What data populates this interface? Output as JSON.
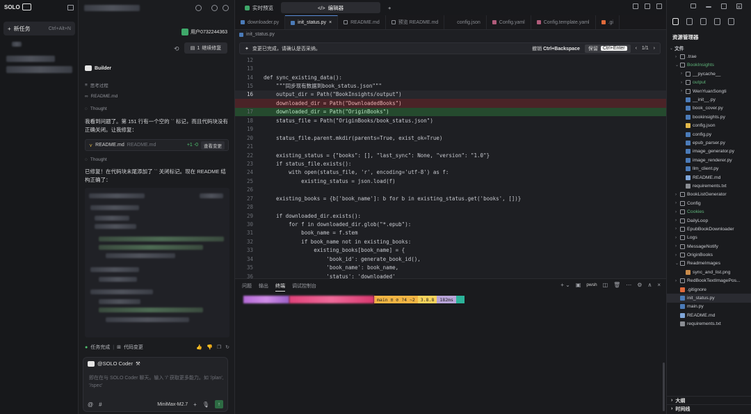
{
  "sidebar": {
    "logo_text": "SOLO",
    "new_task_label": "新任务",
    "new_task_shortcut": "Ctrl+Alt+N"
  },
  "chat": {
    "user_label": "用户0732244363",
    "continue_edit_label": "继续修复",
    "continue_edit_count": "1",
    "agent_name": "Builder",
    "think_process_label": "思考过程",
    "readme_ref": "README.md",
    "thought_label": "Thought",
    "message1": "我看到问题了。第 151 行有一个空的 `` 标记，而且代码块没有正确关闭。让我修复：",
    "file_card": {
      "name": "README.md",
      "path": "README.md",
      "diff": "+1 -0",
      "view_label": "查看变更"
    },
    "thought_label_2": "Thought",
    "message2": "已修复！在代码块末尾添加了 `` 关闭标记。现在 README 结构正确了：",
    "task_done_label": "任务完成",
    "code_changes_label": "代码变更",
    "input": {
      "agent_chip": "@SOLO Coder",
      "placeholder": "即在在与 SOLO Coder 聊天。输入 '/' 获取更多能力。如 '/plan', '/spec'",
      "model": "MiniMax-M2.7"
    }
  },
  "editor": {
    "top_tabs": [
      {
        "label": "实时预览"
      },
      {
        "label": "编辑器"
      }
    ],
    "file_tabs": [
      {
        "label": "downloader.py"
      },
      {
        "label": "init_status.py"
      },
      {
        "label": "README.md"
      },
      {
        "label": "预览 README.md"
      },
      {
        "label": "config.json"
      },
      {
        "label": "Config.yaml"
      },
      {
        "label": "Config.template.yaml"
      },
      {
        "label": ".gi"
      }
    ],
    "breadcrumb": "init_status.py",
    "banner": {
      "message": "变更已完成，请确认是否采纳。",
      "reject_label": "撤销",
      "reject_shortcut": "Ctrl+Backspace",
      "keep_label": "保留",
      "keep_shortcut": "Ctrl+Enter",
      "page": "1/1"
    },
    "code_lines": [
      {
        "n": "12",
        "t": "",
        "k": ""
      },
      {
        "n": "13",
        "t": "",
        "k": ""
      },
      {
        "n": "14",
        "t": "def sync_existing_data():",
        "k": ""
      },
      {
        "n": "15",
        "t": "    \"\"\"同步现有数据到book_status.json\"\"\"",
        "k": ""
      },
      {
        "n": "16",
        "t": "    output_dir = Path(\"BookInsights/output\")",
        "k": "cur"
      },
      {
        "n": "",
        "t": "    downloaded_dir = Path(\"DownloadedBooks\")",
        "k": "del"
      },
      {
        "n": "17",
        "t": "    downloaded_dir = Path(\"OriginBooks\")",
        "k": "add"
      },
      {
        "n": "18",
        "t": "    status_file = Path(\"OriginBooks/book_status.json\")",
        "k": ""
      },
      {
        "n": "19",
        "t": "",
        "k": ""
      },
      {
        "n": "20",
        "t": "    status_file.parent.mkdir(parents=True, exist_ok=True)",
        "k": ""
      },
      {
        "n": "21",
        "t": "",
        "k": ""
      },
      {
        "n": "22",
        "t": "    existing_status = {\"books\": [], \"last_sync\": None, \"version\": \"1.0\"}",
        "k": ""
      },
      {
        "n": "23",
        "t": "    if status_file.exists():",
        "k": ""
      },
      {
        "n": "24",
        "t": "        with open(status_file, 'r', encoding='utf-8') as f:",
        "k": ""
      },
      {
        "n": "25",
        "t": "            existing_status = json.load(f)",
        "k": ""
      },
      {
        "n": "26",
        "t": "",
        "k": ""
      },
      {
        "n": "27",
        "t": "    existing_books = {b['book_name']: b for b in existing_status.get('books', [])}",
        "k": ""
      },
      {
        "n": "28",
        "t": "",
        "k": ""
      },
      {
        "n": "29",
        "t": "    if downloaded_dir.exists():",
        "k": ""
      },
      {
        "n": "30",
        "t": "        for f in downloaded_dir.glob(\"*.epub\"):",
        "k": ""
      },
      {
        "n": "31",
        "t": "            book_name = f.stem",
        "k": ""
      },
      {
        "n": "32",
        "t": "            if book_name not in existing_books:",
        "k": ""
      },
      {
        "n": "33",
        "t": "                existing_books[book_name] = {",
        "k": ""
      },
      {
        "n": "34",
        "t": "                    'book_id': generate_book_id(),",
        "k": ""
      },
      {
        "n": "35",
        "t": "                    'book_name': book_name,",
        "k": ""
      },
      {
        "n": "36",
        "t": "                    'status': 'downloaded'",
        "k": ""
      }
    ],
    "panel": {
      "tabs": [
        "问题",
        "输出",
        "终端",
        "调试控制台"
      ],
      "shell": "pwsh",
      "prompt": {
        "git": " main ≡ ⊘ ?4 ~2",
        "version": " 3.8.8",
        "time": " 182ms"
      }
    }
  },
  "explorer": {
    "title": "资源管理器",
    "tree": [
      {
        "label": "文件",
        "d": 0,
        "type": "section"
      },
      {
        "label": ".trae",
        "d": 1,
        "type": "folder",
        "open": false
      },
      {
        "label": "BookInsights",
        "d": 1,
        "type": "folder",
        "open": true,
        "green": true
      },
      {
        "label": "__pycache__",
        "d": 2,
        "type": "folder",
        "open": false
      },
      {
        "label": "output",
        "d": 2,
        "type": "folder",
        "open": false,
        "green": true
      },
      {
        "label": "WenYuanSongti",
        "d": 2,
        "type": "folder",
        "open": false
      },
      {
        "label": "__init__.py",
        "d": 2,
        "type": "py"
      },
      {
        "label": "book_cover.py",
        "d": 2,
        "type": "py"
      },
      {
        "label": "bookinsights.py",
        "d": 2,
        "type": "py"
      },
      {
        "label": "config.json",
        "d": 2,
        "type": "json"
      },
      {
        "label": "config.py",
        "d": 2,
        "type": "py"
      },
      {
        "label": "epub_parser.py",
        "d": 2,
        "type": "py"
      },
      {
        "label": "image_generator.py",
        "d": 2,
        "type": "py"
      },
      {
        "label": "image_renderer.py",
        "d": 2,
        "type": "py"
      },
      {
        "label": "llm_client.py",
        "d": 2,
        "type": "py"
      },
      {
        "label": "README.md",
        "d": 2,
        "type": "md"
      },
      {
        "label": "requirements.txt",
        "d": 2,
        "type": "txt"
      },
      {
        "label": "BookListGenerator",
        "d": 1,
        "type": "folder",
        "open": false
      },
      {
        "label": "Config",
        "d": 1,
        "type": "folder",
        "open": false
      },
      {
        "label": "Cookies",
        "d": 1,
        "type": "folder",
        "open": false,
        "green": true
      },
      {
        "label": "DailyLoop",
        "d": 1,
        "type": "folder",
        "open": false
      },
      {
        "label": "EpubBookDownloader",
        "d": 1,
        "type": "folder",
        "open": false
      },
      {
        "label": "Logs",
        "d": 1,
        "type": "folder",
        "open": false
      },
      {
        "label": "MessageNotify",
        "d": 1,
        "type": "folder",
        "open": false
      },
      {
        "label": "OriginBooks",
        "d": 1,
        "type": "folder",
        "open": false
      },
      {
        "label": "ReadmeImages",
        "d": 1,
        "type": "folder",
        "open": true
      },
      {
        "label": "sync_and_list.png",
        "d": 2,
        "type": "png"
      },
      {
        "label": "RedBookTextImagePos...",
        "d": 1,
        "type": "folder",
        "open": false
      },
      {
        "label": ".gitignore",
        "d": 1,
        "type": "git"
      },
      {
        "label": "init_status.py",
        "d": 1,
        "type": "py",
        "sel": true
      },
      {
        "label": "main.py",
        "d": 1,
        "type": "py"
      },
      {
        "label": "README.md",
        "d": 1,
        "type": "md"
      },
      {
        "label": "requirements.txt",
        "d": 1,
        "type": "txt"
      }
    ],
    "outline_label": "大纲",
    "timeline_label": "时间线"
  }
}
